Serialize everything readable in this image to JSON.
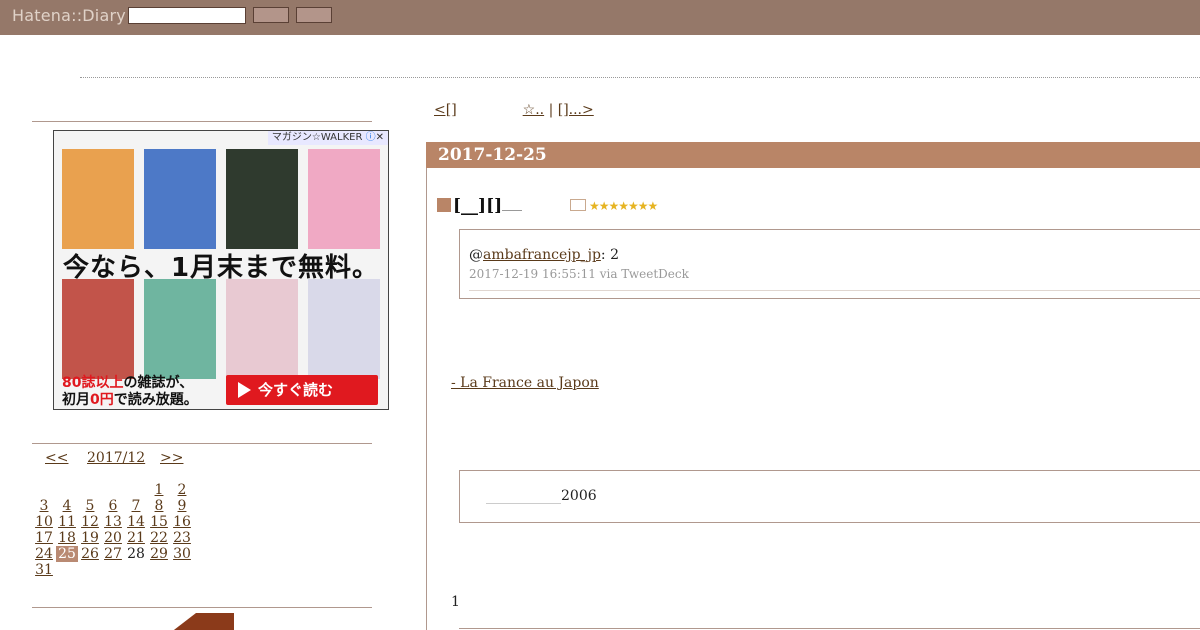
{
  "header": {
    "logo": "Hatena::Diary"
  },
  "top_nav": {
    "prev": "<[]",
    "prev_tail": "☆..",
    "sep": "|",
    "next": "[]...>"
  },
  "ad": {
    "badge": "マガジン☆WALKER",
    "headline": "今なら、1月末まで無料。",
    "sub_line1_red": "80誌以上",
    "sub_line1_rest": "の雑誌が、",
    "sub_line2_prefix": "初月",
    "sub_line2_red": "0円",
    "sub_line2_rest": "で読み放題。",
    "cta": "今すぐ読む",
    "cover_colors": [
      "#e9a14f",
      "#4d79c7",
      "#2f3a2e",
      "#f0a9c4",
      "#c2544a",
      "#6fb5a0",
      "#e8c9d2",
      "#d9d9e9"
    ]
  },
  "calendar": {
    "prev": "<<",
    "month": "2017/12",
    "next": ">>",
    "days": [
      "1",
      "2",
      "3",
      "4",
      "5",
      "6",
      "7",
      "8",
      "9",
      "10",
      "11",
      "12",
      "13",
      "14",
      "15",
      "16",
      "17",
      "18",
      "19",
      "20",
      "21",
      "22",
      "23",
      "24",
      "25",
      "26",
      "27",
      "28",
      "29",
      "30",
      "31"
    ],
    "today": "25",
    "unlinked": "28"
  },
  "entry": {
    "date": "2017-12-25",
    "title": "[__][]",
    "stars": "★★★★★★★",
    "tweet": {
      "mention": "@",
      "user": "ambafrancejp_jp",
      "text": ": 2",
      "meta": "2017-12-19 16:55:11 via TweetDeck"
    },
    "link": "- La France au Japon",
    "quote": "2006",
    "number": "1"
  },
  "colors": {
    "header_bg": "#957869",
    "accent": "#b98567",
    "link": "#5a3a1a"
  }
}
